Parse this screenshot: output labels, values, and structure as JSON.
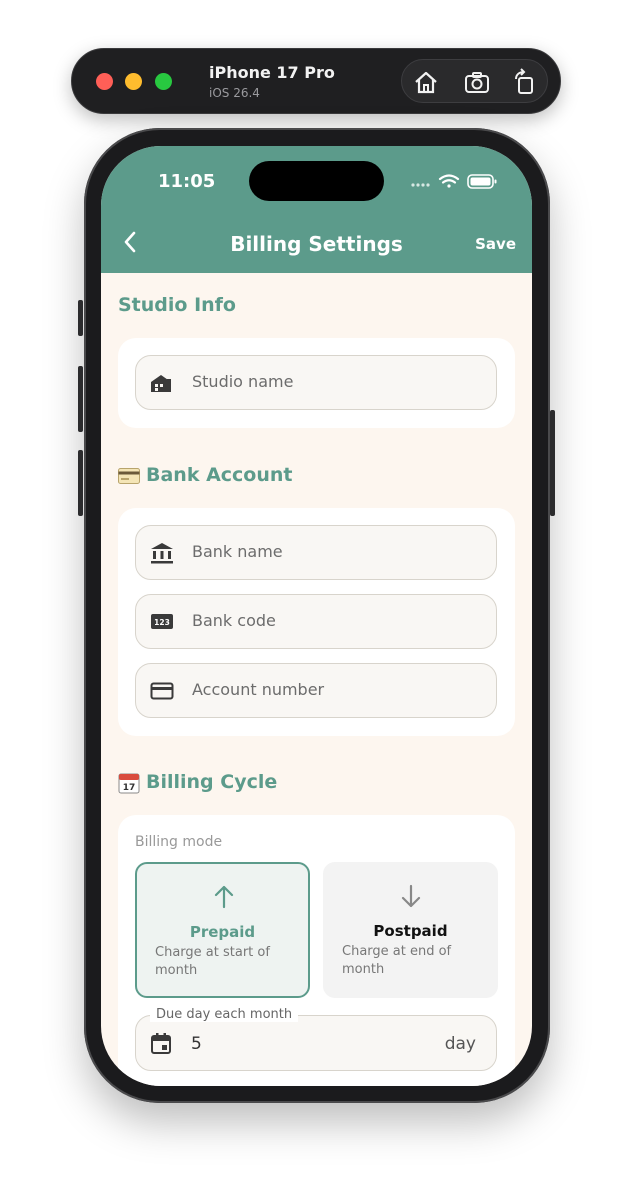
{
  "simulator": {
    "device": "iPhone 17 Pro",
    "os": "iOS 26.4",
    "actions": [
      "home-icon",
      "screenshot-icon",
      "rotate-icon"
    ]
  },
  "status_bar": {
    "time": "11:05"
  },
  "nav": {
    "title": "Billing Settings",
    "save_label": "Save",
    "back_icon": "chevron-left-icon"
  },
  "colors": {
    "accent": "#5c9b8b",
    "background": "#fdf6ef",
    "card": "#ffffff"
  },
  "studio_info": {
    "title": "Studio Info",
    "studio_name_placeholder": "Studio name"
  },
  "bank_account": {
    "title": "Bank Account",
    "emoji": "credit-card-icon",
    "fields": [
      {
        "icon": "bank-icon",
        "placeholder": "Bank name"
      },
      {
        "icon": "numbers-123-icon",
        "placeholder": "Bank code"
      },
      {
        "icon": "card-icon",
        "placeholder": "Account number"
      }
    ]
  },
  "billing_cycle": {
    "title": "Billing Cycle",
    "emoji": "calendar-icon",
    "mode_label": "Billing mode",
    "modes": [
      {
        "title": "Prepaid",
        "description": "Charge at start of month",
        "selected": true
      },
      {
        "title": "Postpaid",
        "description": "Charge at end of month",
        "selected": false
      }
    ],
    "due_day": {
      "label": "Due day each month",
      "value": "5",
      "unit": "day"
    }
  }
}
